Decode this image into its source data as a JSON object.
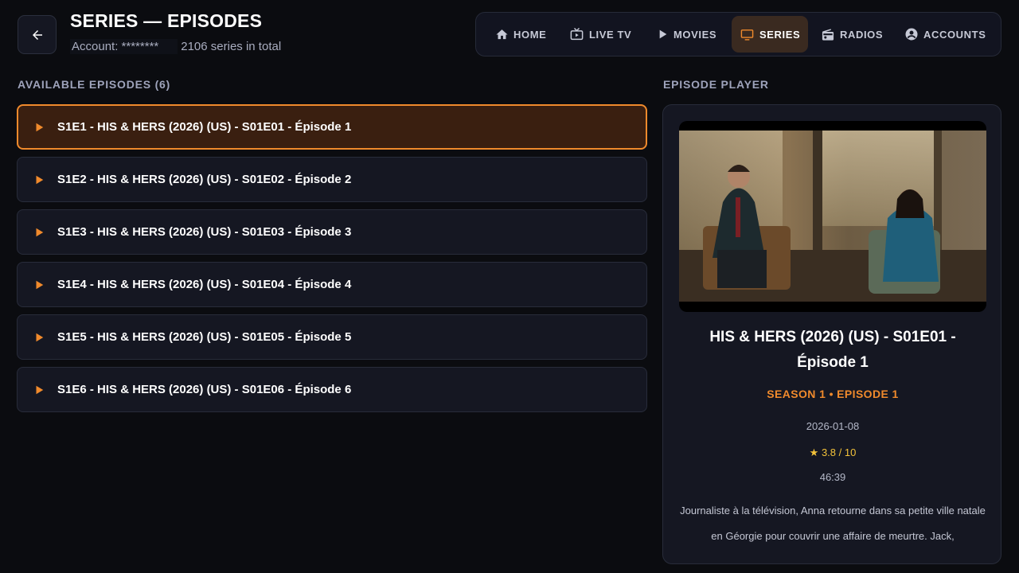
{
  "header": {
    "title": "SERIES — EPISODES",
    "account_label": "Account:",
    "account_masked": "********",
    "total_text": "2106 series in total"
  },
  "nav": {
    "items": [
      {
        "label": "HOME",
        "icon": "home-icon"
      },
      {
        "label": "LIVE TV",
        "icon": "tv-icon"
      },
      {
        "label": "MOVIES",
        "icon": "play-icon"
      },
      {
        "label": "SERIES",
        "icon": "monitor-icon",
        "active": true
      },
      {
        "label": "RADIOS",
        "icon": "radio-icon"
      },
      {
        "label": "ACCOUNTS",
        "icon": "account-circle-icon"
      }
    ]
  },
  "episodes": {
    "section_label": "AVAILABLE EPISODES (6)",
    "items": [
      {
        "label": "S1E1 - HIS & HERS (2026) (US) - S01E01 - Épisode 1",
        "selected": true
      },
      {
        "label": "S1E2 - HIS & HERS (2026) (US) - S01E02 - Épisode 2"
      },
      {
        "label": "S1E3 - HIS & HERS (2026) (US) - S01E03 - Épisode 3"
      },
      {
        "label": "S1E4 - HIS & HERS (2026) (US) - S01E04 - Épisode 4"
      },
      {
        "label": "S1E5 - HIS & HERS (2026) (US) - S01E05 - Épisode 5"
      },
      {
        "label": "S1E6 - HIS & HERS (2026) (US) - S01E06 - Épisode 6"
      }
    ]
  },
  "player": {
    "section_label": "EPISODE PLAYER",
    "title": "HIS & HERS (2026) (US) - S01E01 - Épisode 1",
    "season_episode": "SEASON 1 • EPISODE 1",
    "date": "2026-01-08",
    "rating": "★ 3.8 / 10",
    "duration": "46:39",
    "description": "Journaliste à la télévision, Anna retourne dans sa petite ville natale en Géorgie pour couvrir une affaire de meurtre. Jack,"
  },
  "colors": {
    "accent": "#f08a2c",
    "background": "#0b0c10",
    "panel": "#151722",
    "selected_row": "#3a1f10",
    "rating": "#f3c23a"
  }
}
